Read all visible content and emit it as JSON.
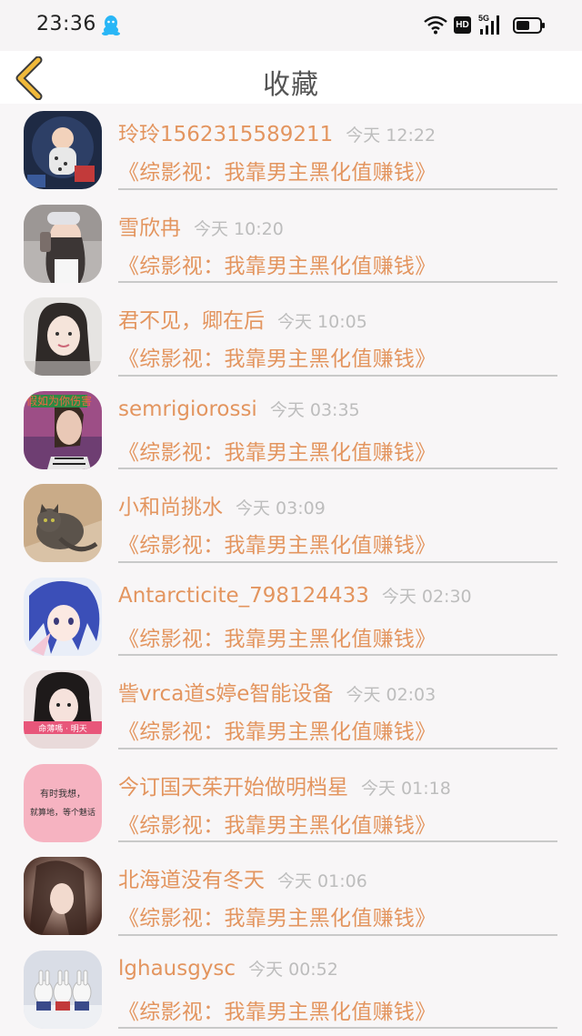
{
  "status_bar": {
    "time": "23:36",
    "hd_label": "HD",
    "network_label": "5G"
  },
  "header": {
    "title": "收藏"
  },
  "items": [
    {
      "name": "玲玲1562315589211",
      "time": "今天 12:22",
      "book": "《综影视：我靠男主黑化值赚钱》"
    },
    {
      "name": "雪欣冉",
      "time": "今天 10:20",
      "book": "《综影视：我靠男主黑化值赚钱》"
    },
    {
      "name": "君不见，卿在后",
      "time": "今天 10:05",
      "book": "《综影视：我靠男主黑化值赚钱》"
    },
    {
      "name": "semrigiorossi",
      "time": "今天 03:35",
      "book": "《综影视：我靠男主黑化值赚钱》"
    },
    {
      "name": "小和尚挑水",
      "time": "今天 03:09",
      "book": "《综影视：我靠男主黑化值赚钱》"
    },
    {
      "name": "Antarcticite_798124433",
      "time": "今天 02:30",
      "book": "《综影视：我靠男主黑化值赚钱》"
    },
    {
      "name": "訾vrca道s婷e智能设备",
      "time": "今天 02:03",
      "book": "《综影视：我靠男主黑化值赚钱》"
    },
    {
      "name": "今订国天茱开始做明档星",
      "time": "今天 01:18",
      "book": "《综影视：我靠男主黑化值赚钱》"
    },
    {
      "name": "北海道没有冬天",
      "time": "今天 01:06",
      "book": "《综影视：我靠男主黑化值赚钱》"
    },
    {
      "name": "lghausgysc",
      "time": "今天 00:52",
      "book": "《综影视：我靠男主黑化值赚钱》"
    }
  ],
  "avatars": {
    "item_4_caption": "假如为你伤害",
    "item_7_caption": "命薄嗎 · 明天",
    "item_8_caption_line1": "有时我想，",
    "item_8_caption_line2": "就算地，等个魅话"
  },
  "colors": {
    "accent": "#e3955f",
    "timestamp": "#bdbdbd",
    "divider": "#c9c9c9",
    "back_arrow": "#f0b93a",
    "qq_blue": "#29b6f6"
  }
}
